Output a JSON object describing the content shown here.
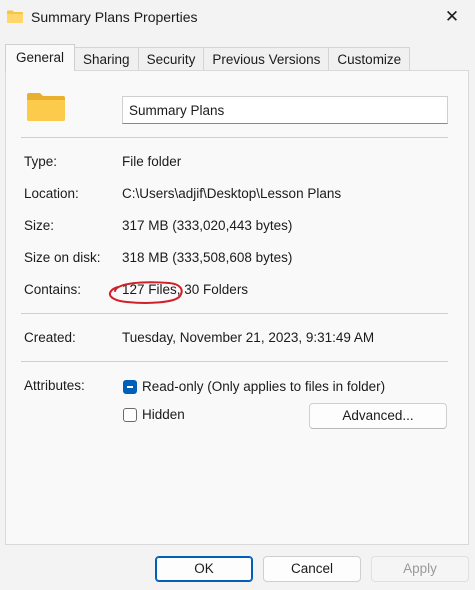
{
  "window": {
    "title": "Summary Plans Properties",
    "close_glyph": "✕",
    "icons": {
      "title_icon": "folder-icon",
      "close_icon": "close-icon"
    }
  },
  "tabs": [
    {
      "label": "General",
      "active": true
    },
    {
      "label": "Sharing",
      "active": false
    },
    {
      "label": "Security",
      "active": false
    },
    {
      "label": "Previous Versions",
      "active": false
    },
    {
      "label": "Customize",
      "active": false
    }
  ],
  "general": {
    "folder_icon": "folder-icon",
    "name_value": "Summary Plans",
    "type_label": "Type:",
    "type_value": "File folder",
    "location_label": "Location:",
    "location_value": "C:\\Users\\adjif\\Desktop\\Lesson Plans",
    "size_label": "Size:",
    "size_value": "317 MB (333,020,443 bytes)",
    "size_on_disk_label": "Size on disk:",
    "size_on_disk_value": "318 MB (333,508,608 bytes)",
    "contains_label": "Contains:",
    "contains_value": "127 Files, 30 Folders",
    "created_label": "Created:",
    "created_value": "Tuesday, November 21, 2023, 9:31:49 AM",
    "attributes_label": "Attributes:",
    "readonly_label": "Read-only (Only applies to files in folder)",
    "readonly_checked": true,
    "hidden_label": "Hidden",
    "hidden_checked": false,
    "advanced_label": "Advanced...",
    "annotation_color": "#d0202a"
  },
  "buttons": {
    "ok": "OK",
    "cancel": "Cancel",
    "apply": "Apply"
  },
  "colors": {
    "accent": "#005fb8",
    "folder": "#f6c544"
  }
}
